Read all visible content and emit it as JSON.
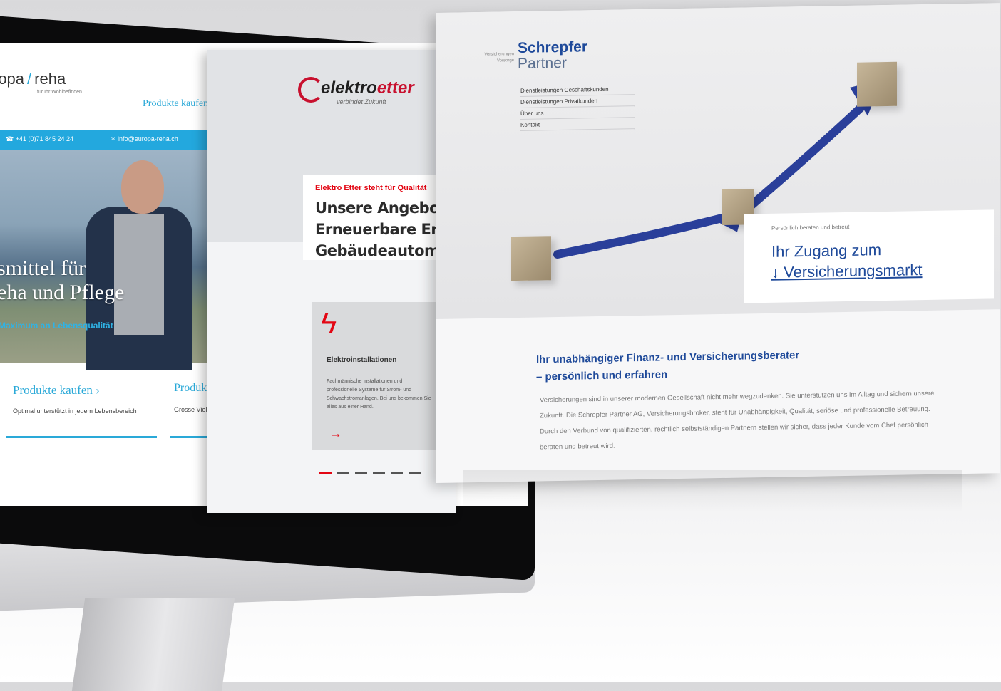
{
  "europa_reha": {
    "logo_left": "ropa",
    "logo_right": "reha",
    "logo_tagline": "für Ihr Wohlbefinden",
    "nav_item": "Produkte kaufen",
    "phone": "+41 (0)71 845 24 24",
    "email": "info@europa-reha.ch",
    "hero_title_line1": "smittel für",
    "hero_title_line2": "eha und Pflege",
    "hero_subtitle": "Maximum an Lebensqualität",
    "card1_link": "Produkte kaufen ›",
    "card1_text": "Optimal unterstützt in jedem Lebensbereich",
    "card2_link": "Produkte r",
    "card2_text": "Grosse Vielfalt für"
  },
  "elektroetter": {
    "logo_prefix": "elektro",
    "logo_suffix": "etter",
    "logo_sub": "verbindet Zukunft",
    "claim": "Elektro Etter steht für Qualität",
    "headline_lines": [
      "Unsere Angebotspa",
      "Erneuerbare Energi",
      "Gebäudeautomatio"
    ],
    "card_title": "Elektroinstallationen",
    "card_text": "Fachmännische Installationen und professionelle Systeme für Strom- und Schwachstromanlagen. Bei uns bekommen Sie alles aus einer Hand.",
    "card_arrow": "→"
  },
  "schrepfer": {
    "kicker": "Versicherungen Vorsorge",
    "brand_line1": "Schrepfer",
    "brand_line2": "Partner",
    "menu": [
      "Dienstleistungen Geschäftskunden",
      "Dienstleistungen Privatkunden",
      "Über uns",
      "Kontakt"
    ],
    "hero_kicker": "Persönlich beraten und betreut",
    "hero_title": "Ihr Zugang zum",
    "hero_link": "↓ Versicherungsmarkt",
    "heading_line1": "Ihr unabhängiger Finanz- und Versicherungsberater",
    "heading_line2": "– persönlich und erfahren",
    "body": "Versicherungen sind in unserer modernen Gesellschaft nicht mehr wegzudenken. Sie unterstützen uns im Alltag und sichern unsere Zukunft. Die Schrepfer Partner AG, Versicherungsbroker, steht für Unabhängigkeit, Qualität, seriöse und professionelle Betreuung. Durch den Verbund von qualifizierten, rechtlich selbstständigen Partnern stellen wir sicher, dass jeder Kunde vom Chef persönlich beraten und betreut wird."
  },
  "colors": {
    "europa_blue": "#23a8de",
    "etter_red": "#e30613",
    "schrepfer_blue": "#1f4a9a"
  }
}
